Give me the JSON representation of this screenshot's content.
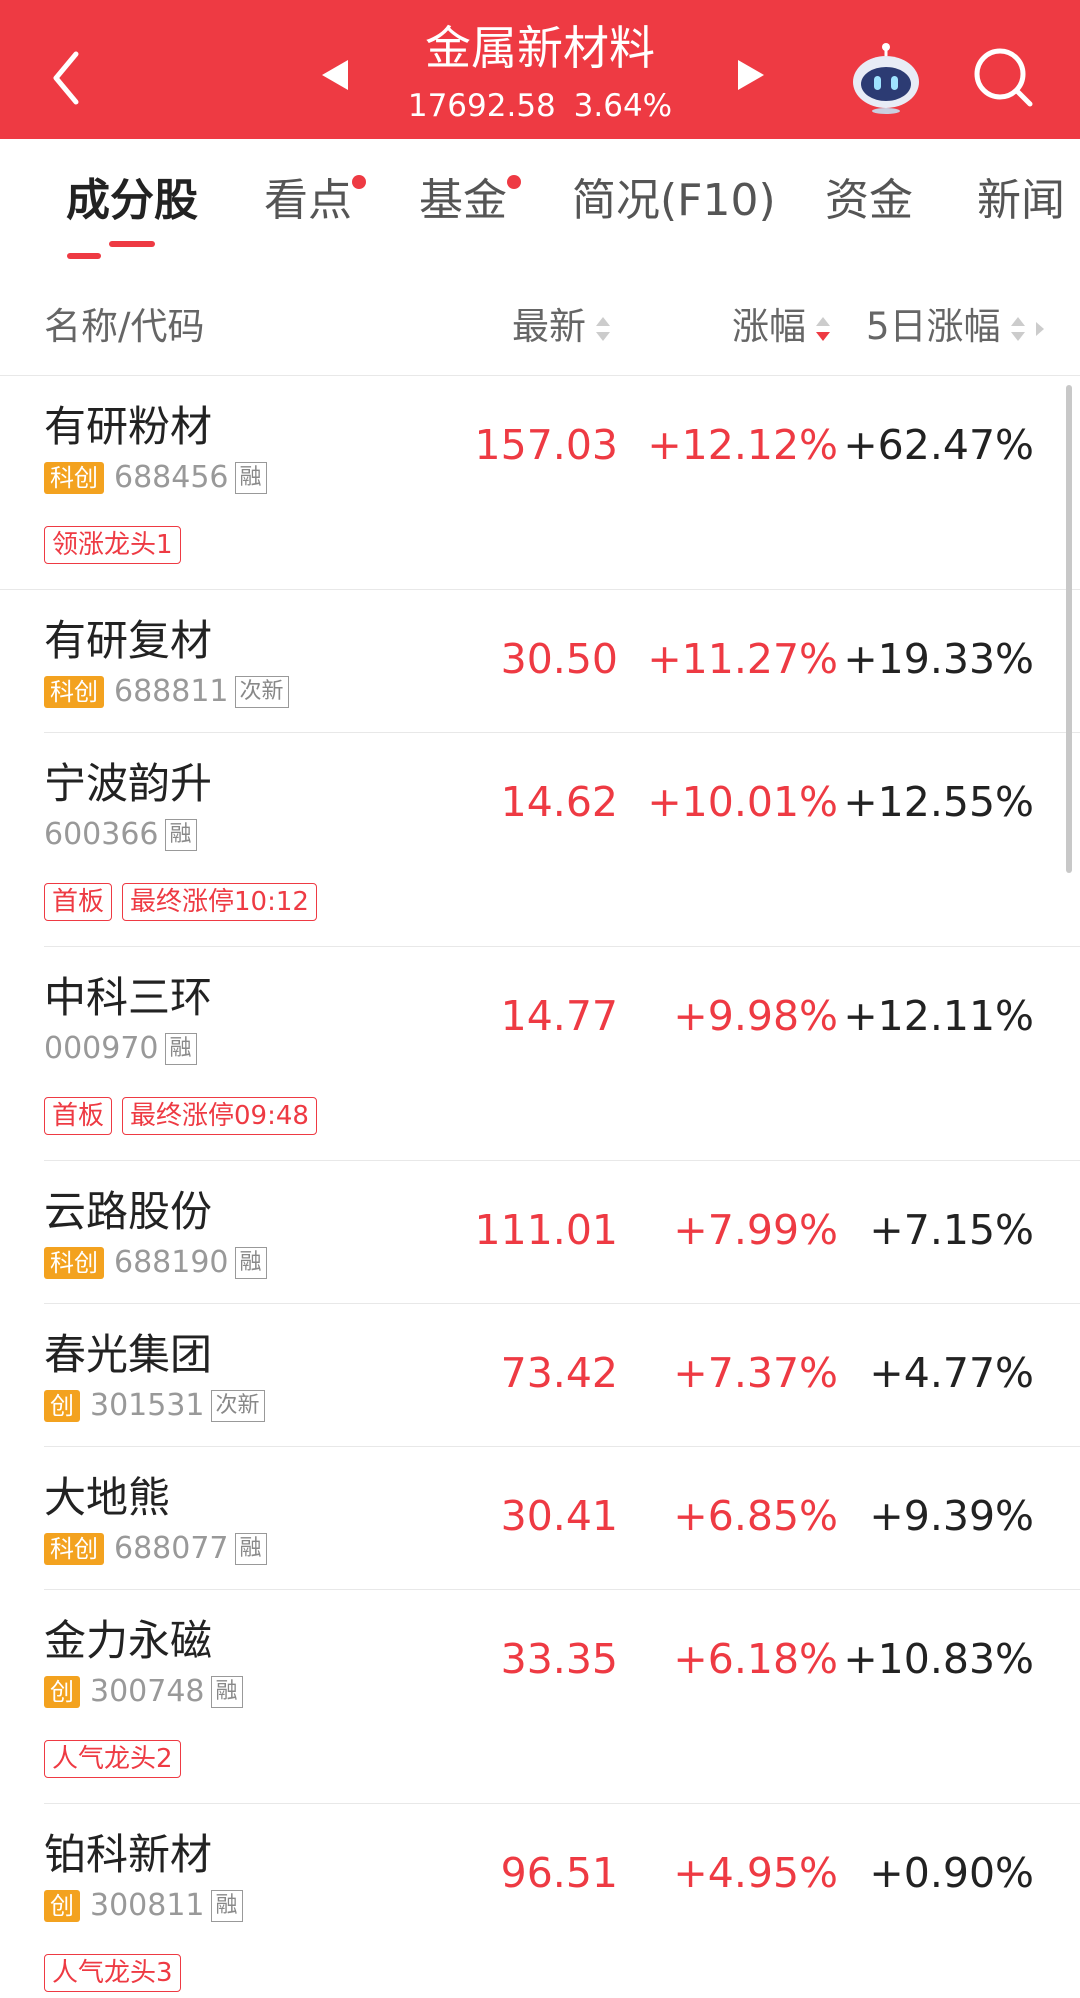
{
  "header": {
    "title": "金属新材料",
    "index_value": "17692.58",
    "index_change": "3.64%",
    "colors": {
      "bar": "#ee3a43",
      "up": "#ee3a43",
      "board_badge": "#f3a21f"
    }
  },
  "icons": {
    "back": "back-chevron-icon",
    "prev": "prev-triangle-icon",
    "next": "next-triangle-icon",
    "assistant": "robot-assistant-icon",
    "search": "search-icon"
  },
  "tabs": [
    {
      "label": "成分股",
      "active": true,
      "dot": false
    },
    {
      "label": "看点",
      "active": false,
      "dot": true
    },
    {
      "label": "基金",
      "active": false,
      "dot": true
    },
    {
      "label": "简况(F10)",
      "active": false,
      "dot": false
    },
    {
      "label": "资金",
      "active": false,
      "dot": false
    },
    {
      "label": "新闻",
      "active": false,
      "dot": false
    }
  ],
  "columns": {
    "name": "名称/代码",
    "latest": "最新",
    "change": "涨幅",
    "change5d": "5日涨幅"
  },
  "stocks": [
    {
      "name": "有研粉材",
      "board": "科创",
      "code": "688456",
      "flag": "融",
      "price": "157.03",
      "change": "+12.12%",
      "change5d": "+62.47%",
      "tags": [
        "领涨龙头1"
      ]
    },
    {
      "name": "有研复材",
      "board": "科创",
      "code": "688811",
      "flag": "次新",
      "price": "30.50",
      "change": "+11.27%",
      "change5d": "+19.33%",
      "tags": []
    },
    {
      "name": "宁波韵升",
      "board": "",
      "code": "600366",
      "flag": "融",
      "price": "14.62",
      "change": "+10.01%",
      "change5d": "+12.55%",
      "tags": [
        "首板",
        "最终涨停10:12"
      ]
    },
    {
      "name": "中科三环",
      "board": "",
      "code": "000970",
      "flag": "融",
      "price": "14.77",
      "change": "+9.98%",
      "change5d": "+12.11%",
      "tags": [
        "首板",
        "最终涨停09:48"
      ]
    },
    {
      "name": "云路股份",
      "board": "科创",
      "code": "688190",
      "flag": "融",
      "price": "111.01",
      "change": "+7.99%",
      "change5d": "+7.15%",
      "tags": []
    },
    {
      "name": "春光集团",
      "board": "创",
      "code": "301531",
      "flag": "次新",
      "price": "73.42",
      "change": "+7.37%",
      "change5d": "+4.77%",
      "tags": []
    },
    {
      "name": "大地熊",
      "board": "科创",
      "code": "688077",
      "flag": "融",
      "price": "30.41",
      "change": "+6.85%",
      "change5d": "+9.39%",
      "tags": []
    },
    {
      "name": "金力永磁",
      "board": "创",
      "code": "300748",
      "flag": "融",
      "price": "33.35",
      "change": "+6.18%",
      "change5d": "+10.83%",
      "tags": [
        "人气龙头2"
      ]
    },
    {
      "name": "铂科新材",
      "board": "创",
      "code": "300811",
      "flag": "融",
      "price": "96.51",
      "change": "+4.95%",
      "change5d": "+0.90%",
      "tags": [
        "人气龙头3"
      ]
    }
  ]
}
